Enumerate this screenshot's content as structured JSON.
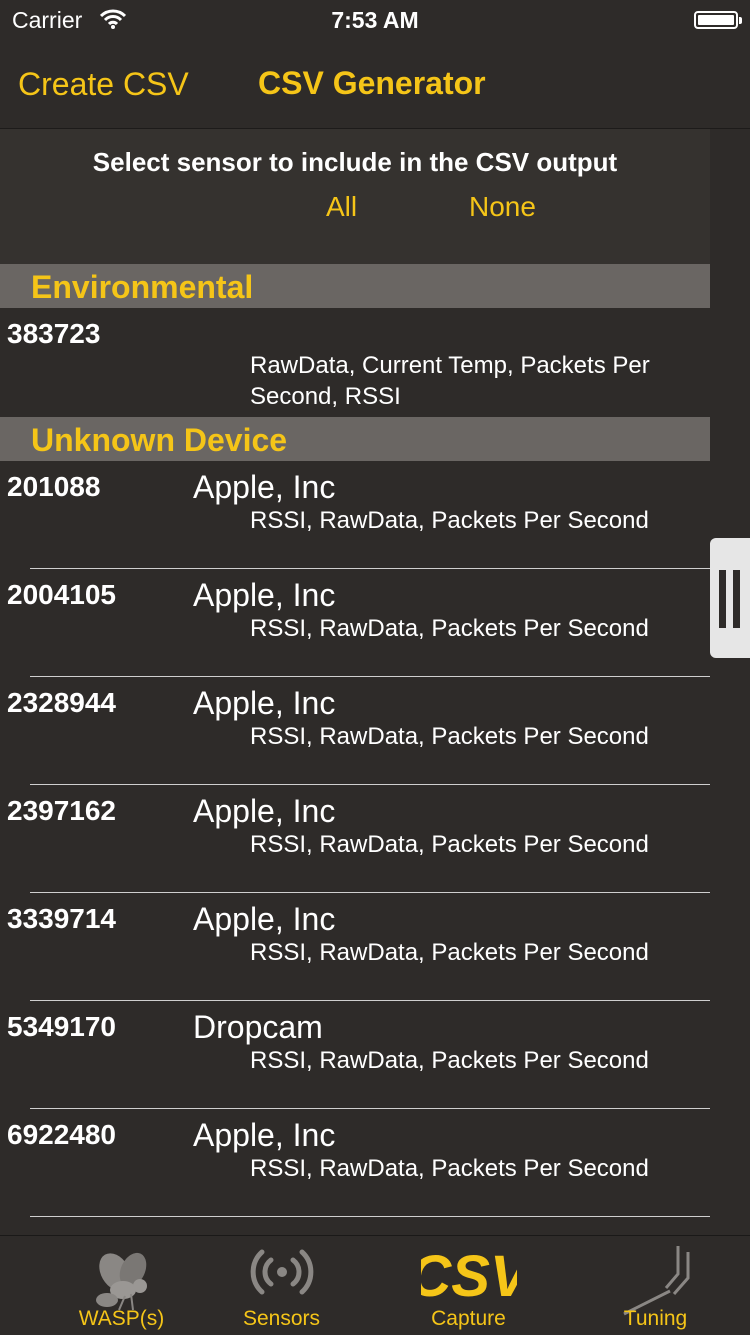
{
  "status": {
    "carrier": "Carrier",
    "time": "7:53 AM"
  },
  "nav": {
    "back_label": "Create CSV",
    "title": "CSV Generator"
  },
  "header": {
    "instruction": "Select sensor to include in the CSV output",
    "all_label": "All",
    "none_label": "None"
  },
  "sections": [
    {
      "title": "Environmental",
      "rows": [
        {
          "id": "383723",
          "vendor": "",
          "fields": "RawData, Current Temp, Packets Per Second, RSSI"
        }
      ]
    },
    {
      "title": "Unknown Device",
      "rows": [
        {
          "id": "201088",
          "vendor": "Apple, Inc",
          "fields": "RSSI, RawData, Packets Per Second"
        },
        {
          "id": "2004105",
          "vendor": "Apple, Inc",
          "fields": "RSSI, RawData, Packets Per Second"
        },
        {
          "id": "2328944",
          "vendor": "Apple, Inc",
          "fields": "RSSI, RawData, Packets Per Second"
        },
        {
          "id": "2397162",
          "vendor": "Apple, Inc",
          "fields": "RSSI, RawData, Packets Per Second"
        },
        {
          "id": "3339714",
          "vendor": "Apple, Inc",
          "fields": "RSSI, RawData, Packets Per Second"
        },
        {
          "id": "5349170",
          "vendor": "Dropcam",
          "fields": "RSSI, RawData, Packets Per Second"
        },
        {
          "id": "6922480",
          "vendor": "Apple, Inc",
          "fields": "RSSI, RawData, Packets Per Second"
        }
      ]
    }
  ],
  "tabs": [
    {
      "label": "WASP(s)",
      "icon": "wasp-icon"
    },
    {
      "label": "Sensors",
      "icon": "signal-icon"
    },
    {
      "label": "Capture",
      "icon": "csv-icon"
    },
    {
      "label": "Tuning",
      "icon": "tuning-fork-icon"
    }
  ],
  "colors": {
    "accent": "#f5c518",
    "background": "#2e2b29",
    "section_header": "#6a6663"
  }
}
